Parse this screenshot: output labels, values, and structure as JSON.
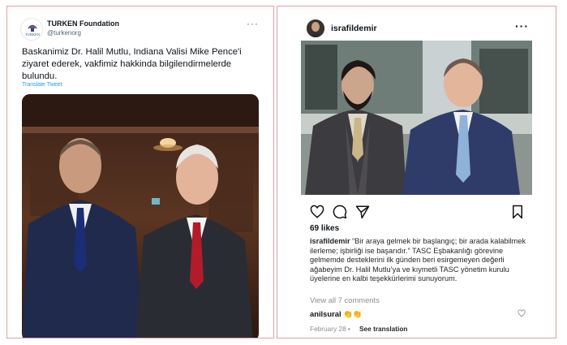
{
  "twitter": {
    "display_name": "TURKEN Foundation",
    "handle": "@turkenorg",
    "avatar_text": "TURKEN",
    "more_label": "···",
    "text": "Baskanimiz Dr. Halil Mutlu, Indiana Valisi Mike Pence'i ziyaret ederek, vakfimiz hakkinda bilgilendirmelerde bulundu.",
    "translate_label": "Translate Tweet"
  },
  "instagram": {
    "username": "israfildemir",
    "more_label": "···",
    "likes": "69 likes",
    "caption_user": "israfildemir",
    "caption_text": " “Bir araya gelmek bir başlangıç; bir arada kalabilmek ilerleme; işbirliği ise başarıdır.” TASC Eşbakanlığı görevine gelmemde desteklerini ilk günden beri esirgemeyen değerli ağabeyim Dr. Halil Mutlu’ya ve kıymetli TASC yönetim kurulu üyelerine en kalbi teşekkürlerimi sunuyorum.",
    "view_comments": "View all 7 comments",
    "comment_user": "anilsural",
    "comment_text": "👏👏",
    "date": "February 28",
    "separator": "•",
    "see_translation": "See translation",
    "icons": [
      "heart-icon",
      "comment-icon",
      "share-icon",
      "bookmark-icon"
    ]
  },
  "colors": {
    "border": "#e3a0a4",
    "twitter_blue": "#1d9bf0",
    "ig_gray": "#8e8e8e"
  }
}
